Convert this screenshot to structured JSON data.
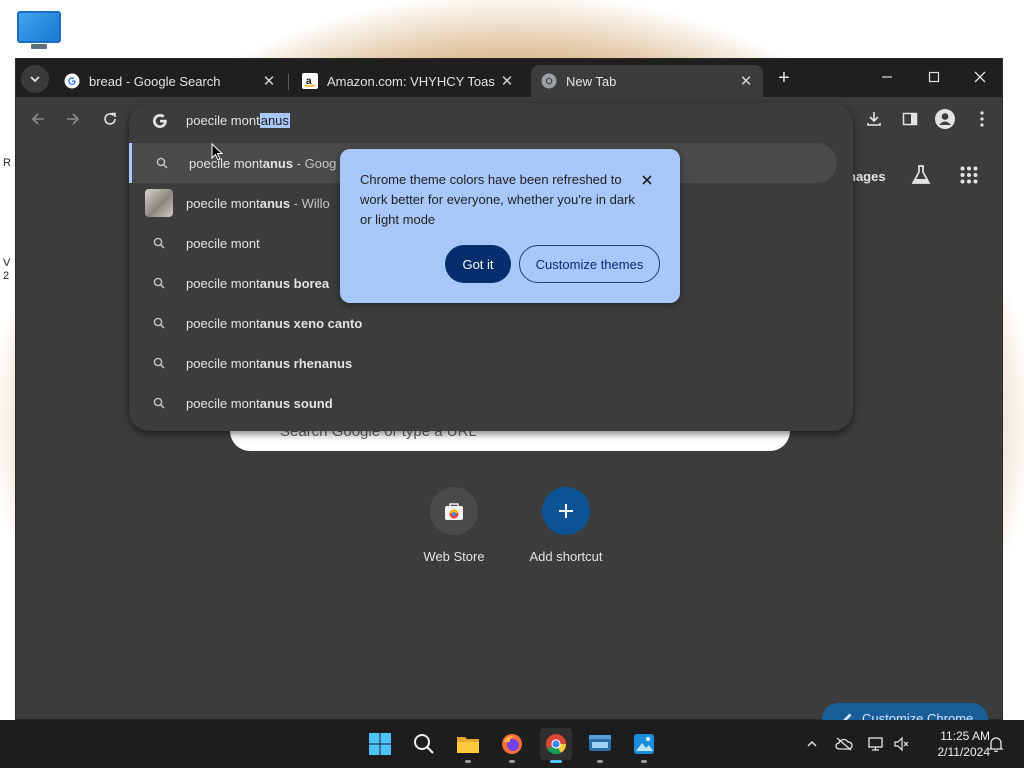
{
  "desktop": {
    "fragment_1": "R",
    "fragment_2": "V",
    "fragment_3": "2"
  },
  "tabs": [
    {
      "title": "bread - Google Search",
      "favicon": "google-icon"
    },
    {
      "title": "Amazon.com: VHYHCY Toast Br",
      "favicon": "amazon-icon"
    },
    {
      "title": "New Tab",
      "favicon": "chrome-icon"
    }
  ],
  "omnibox": {
    "typed": "poecile mont",
    "completion": "anus",
    "suggestions": [
      {
        "prefix": "poecile mont",
        "bold": "anus",
        "suffix": " - Goog"
      },
      {
        "prefix": "poecile mont",
        "bold": "anus",
        "suffix": " - Willo"
      },
      {
        "prefix": "poecile mont",
        "bold": "",
        "suffix": ""
      },
      {
        "prefix": "poecile mont",
        "bold": "anus borea",
        "suffix": ""
      },
      {
        "prefix": "poecile mont",
        "bold": "anus xeno canto",
        "suffix": ""
      },
      {
        "prefix": "poecile mont",
        "bold": "anus rhenanus",
        "suffix": ""
      },
      {
        "prefix": "poecile mont",
        "bold": "anus sound",
        "suffix": ""
      }
    ]
  },
  "popup": {
    "message": "Chrome theme colors have been refreshed to work better for everyone, whether you're in dark or light mode",
    "got_it": "Got it",
    "customize": "Customize themes"
  },
  "page": {
    "images_link": "nages",
    "search_placeholder": "Search Google or type a URL",
    "shortcuts": [
      {
        "label": "Web Store"
      },
      {
        "label": "Add shortcut"
      }
    ],
    "customize_chrome": "Customize Chrome"
  },
  "taskbar": {
    "time": "11:25 AM",
    "date": "2/11/2024"
  },
  "colors": {
    "accent": "#a8c7fa",
    "popup_button": "#062e6f",
    "taskbar": "#1d1d1d"
  }
}
